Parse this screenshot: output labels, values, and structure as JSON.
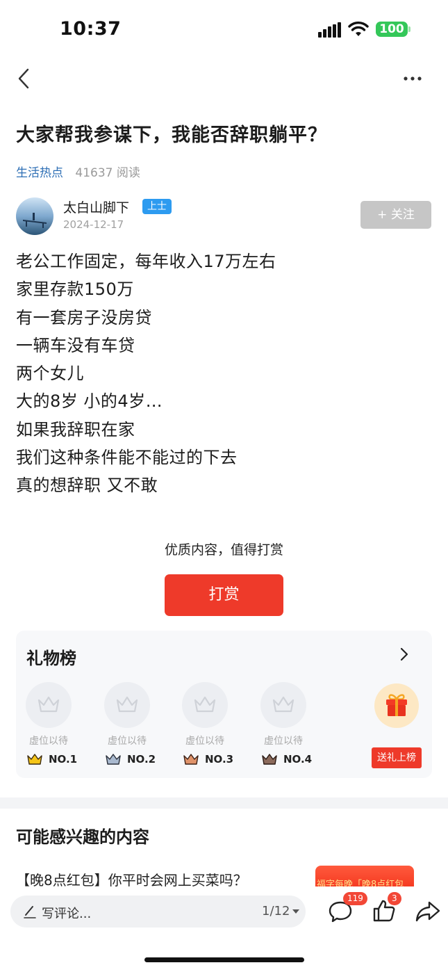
{
  "status_bar": {
    "time": "10:37",
    "battery": "100"
  },
  "post": {
    "title": "大家帮我参谋下，我能否辞职躺平？",
    "category": "生活热点",
    "reads": "41637 阅读",
    "author": {
      "name": "太白山脚下",
      "badge": "上士",
      "date": "2024-12-17"
    },
    "follow_label": "+ 关注",
    "body": [
      "老公工作固定，每年收入17万左右",
      "家里存款150万",
      "有一套房子没房贷",
      "一辆车没有车贷",
      "两个女儿",
      "大的8岁 小的4岁…",
      "如果我辞职在家",
      "我们这种条件能不能过的下去",
      "真的想辞职 又不敢"
    ]
  },
  "reward": {
    "hint": "优质内容，值得打赏",
    "button": "打赏"
  },
  "gift_board": {
    "title": "礼物榜",
    "slots": [
      {
        "label": "虚位以待",
        "rank": "NO.1",
        "color": "#f5c518"
      },
      {
        "label": "虚位以待",
        "rank": "NO.2",
        "color": "#a9b9cf"
      },
      {
        "label": "虚位以待",
        "rank": "NO.3",
        "color": "#e0936a"
      },
      {
        "label": "虚位以待",
        "rank": "NO.4",
        "color": "#8c6b5c"
      }
    ],
    "send_label": "送礼上榜"
  },
  "recommend": {
    "title": "可能感兴趣的内容",
    "item_title": "【晚8点红包】你平时会网上买菜吗？",
    "thumb_text": "福字每晚「晚8点红包"
  },
  "bottom_bar": {
    "comment_placeholder": "写评论...",
    "page_indicator": "1/12",
    "comment_count": "119",
    "like_count": "3"
  }
}
